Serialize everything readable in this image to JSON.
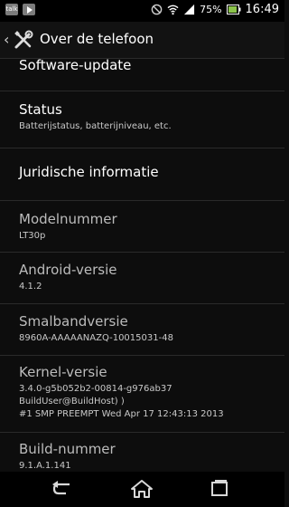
{
  "status_bar": {
    "notification_icons": [
      "talk-icon",
      "play-store-icon",
      "mail-icon"
    ],
    "talk_label": "talk",
    "battery_percent": "75%",
    "time": "16:49",
    "system_icons": [
      "do-not-disturb-icon",
      "wifi-icon",
      "signal-icon",
      "battery-icon"
    ]
  },
  "action_bar": {
    "back_glyph": "‹",
    "title": "Over de telefoon",
    "icon": "settings-tools-icon"
  },
  "items": {
    "software_update": {
      "title": "Software-update"
    },
    "status": {
      "title": "Status",
      "subtitle": "Batterijstatus, batterijniveau, etc."
    },
    "legal": {
      "title": "Juridische informatie"
    },
    "model": {
      "title": "Modelnummer",
      "value": "LT30p"
    },
    "android": {
      "title": "Android-versie",
      "value": "4.1.2"
    },
    "baseband": {
      "title": "Smalbandversie",
      "value": "8960A-AAAAANAZQ-10015031-48"
    },
    "kernel": {
      "title": "Kernel-versie",
      "lines": [
        "3.4.0-g5b052b2-00814-g976ab37",
        "BuildUser@BuildHost) )",
        "#1 SMP PREEMPT Wed Apr 17 12:43:13 2013"
      ]
    },
    "build": {
      "title": "Build-nummer",
      "value": "9.1.A.1.141"
    }
  },
  "nav_bar": {
    "buttons": [
      "back-icon",
      "home-icon",
      "recent-apps-icon"
    ]
  },
  "colors": {
    "background": "#0d0d0d",
    "divider": "#2a2a2a",
    "text_primary": "#ffffff",
    "text_secondary": "#c9c9c9"
  }
}
